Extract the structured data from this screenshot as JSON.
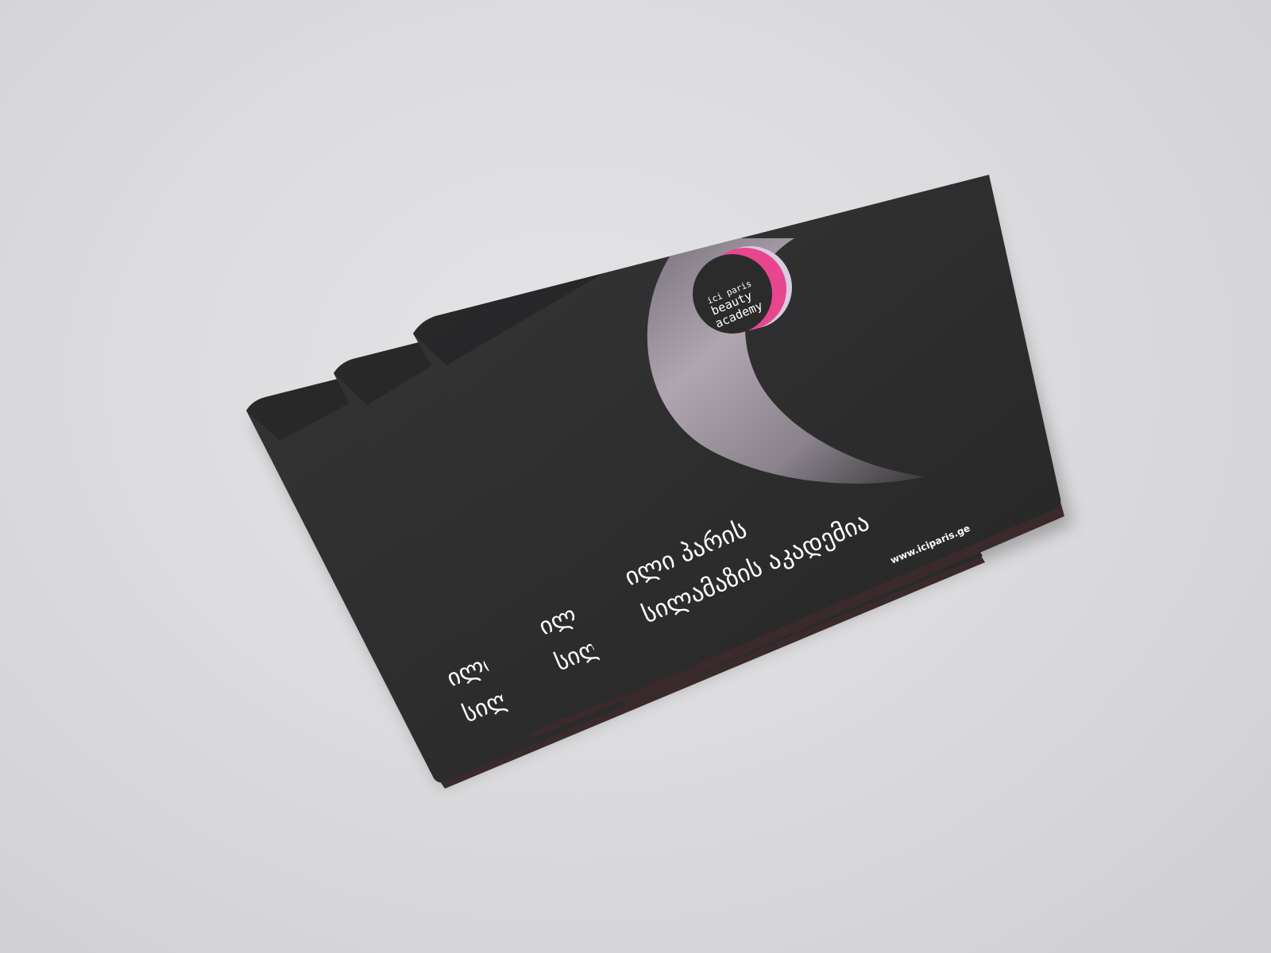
{
  "brand": {
    "logo_line1": "ici paris",
    "logo_line2": "beauty",
    "logo_line3": "academy",
    "accent_pink": "#e8478f",
    "accent_lilac": "#d7cce0"
  },
  "cover": {
    "title_line1": "ილი პარის",
    "title_line2": "სილამაზის აკადემია",
    "website": "www.iciparis.ge",
    "cover_color": "#2c2c2d"
  },
  "stack": {
    "booklet_count": 3
  }
}
